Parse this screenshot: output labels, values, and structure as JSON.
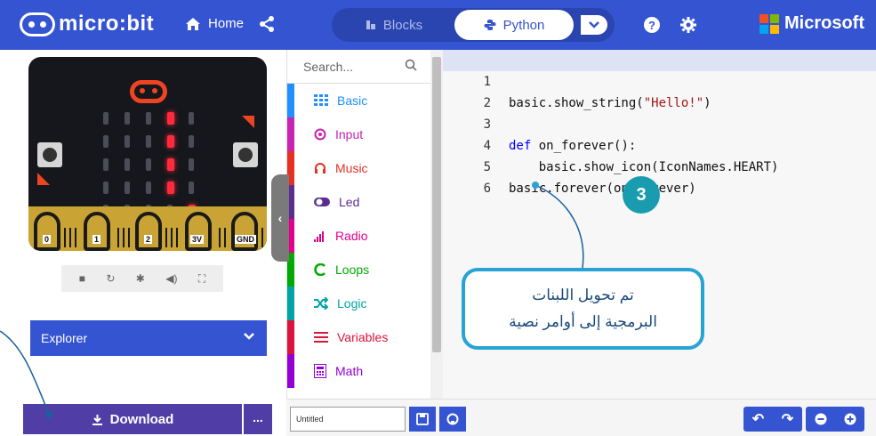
{
  "header": {
    "logo_text": "micro:bit",
    "home_label": "Home",
    "blocks_label": "Blocks",
    "python_label": "Python",
    "brand_label": "Microsoft"
  },
  "simulator": {
    "pins": [
      "0",
      "1",
      "2",
      "3V",
      "GND"
    ],
    "explorer_label": "Explorer"
  },
  "toolbox": {
    "search_placeholder": "Search...",
    "categories": [
      {
        "label": "Basic",
        "color": "#1e90ff"
      },
      {
        "label": "Input",
        "color": "#c724b1"
      },
      {
        "label": "Music",
        "color": "#e63022"
      },
      {
        "label": "Led",
        "color": "#5c2d91"
      },
      {
        "label": "Radio",
        "color": "#e3008c"
      },
      {
        "label": "Loops",
        "color": "#00aa00"
      },
      {
        "label": "Logic",
        "color": "#00a4a6"
      },
      {
        "label": "Variables",
        "color": "#dc143c"
      },
      {
        "label": "Math",
        "color": "#9400d3"
      }
    ]
  },
  "editor": {
    "lines": [
      {
        "num": "1",
        "code": "basic.show_string(\"Hello!\")"
      },
      {
        "num": "2",
        "code": ""
      },
      {
        "num": "3",
        "code": "def on_forever():"
      },
      {
        "num": "4",
        "code": "    basic.show_icon(IconNames.HEART)"
      },
      {
        "num": "5",
        "code": "basic.forever(on_forever)"
      },
      {
        "num": "6",
        "code": ""
      }
    ]
  },
  "annotation": {
    "badge": "3",
    "callout_line1": "تم تحويل اللبنات",
    "callout_line2": "البرمجية إلى أوامر نصية"
  },
  "footer": {
    "download_label": "Download",
    "more_label": "...",
    "project_name": "Untitled"
  },
  "colors": {
    "primary": "#3454d1",
    "download": "#513da6",
    "callout": "#29a3d3",
    "badge": "#1a9cb0"
  }
}
